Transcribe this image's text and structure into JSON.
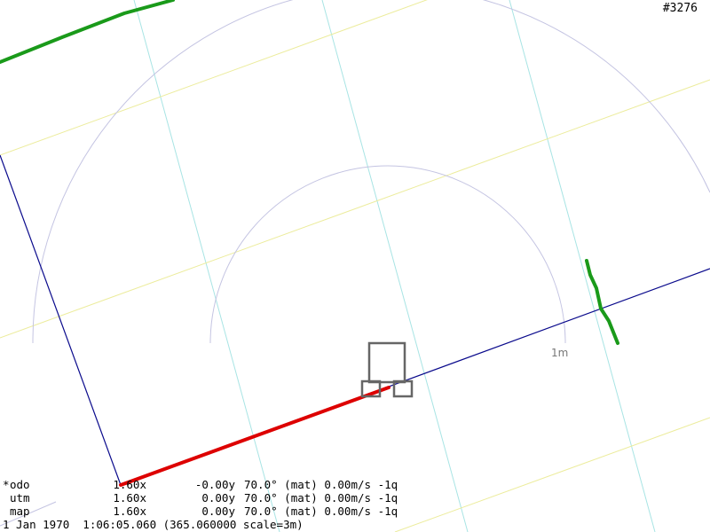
{
  "frame_id": "#3276",
  "scale_ring_label": "1m",
  "pose_rows": [
    {
      "prefix": "*",
      "name": "odo",
      "x": "1.60x",
      "y": "-0.00y",
      "heading": "70.0°",
      "mode": "(mat)",
      "speed": "0.00m/s",
      "q": "-1q"
    },
    {
      "prefix": " ",
      "name": "utm",
      "x": "1.60x",
      "y": "0.00y",
      "heading": "70.0°",
      "mode": "(mat)",
      "speed": "0.00m/s",
      "q": "-1q"
    },
    {
      "prefix": " ",
      "name": "map",
      "x": "1.60x",
      "y": "0.00y",
      "heading": "70.0°",
      "mode": "(mat)",
      "speed": "0.00m/s",
      "q": "-1q"
    }
  ],
  "timestamp_line": "1 Jan 1970  1:06:05.060 (365.060000 scale=3m)",
  "colors": {
    "background": "#ffffff",
    "grid_cyan": "#a8e4e4",
    "grid_yellow": "#ecec9c",
    "range_rings": "#c4c4e2",
    "axis": "#0a0a8c",
    "odometry_trail": "#dd0000",
    "obstacles": "#1a9a1a",
    "robot": "#666666"
  }
}
